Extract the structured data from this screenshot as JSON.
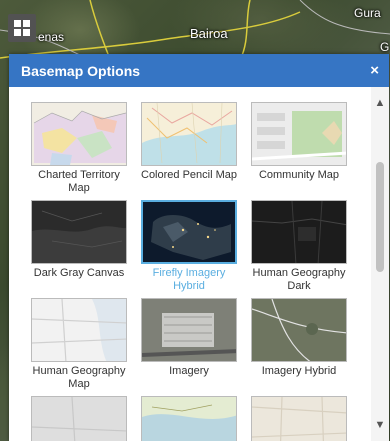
{
  "map": {
    "labels": [
      "enas",
      "Bairoa",
      "Gura",
      "G"
    ]
  },
  "dialog": {
    "title": "Basemap Options",
    "close_symbol": "×"
  },
  "basemaps": [
    {
      "label": "Charted Territory Map",
      "icon": "charted-territory-thumb"
    },
    {
      "label": "Colored Pencil Map",
      "icon": "colored-pencil-thumb"
    },
    {
      "label": "Community Map",
      "icon": "community-thumb"
    },
    {
      "label": "Dark Gray Canvas",
      "icon": "dark-gray-thumb"
    },
    {
      "label": "Firefly Imagery Hybrid",
      "icon": "firefly-thumb",
      "selected": true
    },
    {
      "label": "Human Geography Dark",
      "icon": "human-geo-dark-thumb"
    },
    {
      "label": "Human Geography Map",
      "icon": "human-geo-map-thumb"
    },
    {
      "label": "Imagery",
      "icon": "imagery-thumb"
    },
    {
      "label": "Imagery Hybrid",
      "icon": "imagery-hybrid-thumb"
    }
  ],
  "colors": {
    "header": "#3675c4",
    "selected": "#5aaee0"
  }
}
